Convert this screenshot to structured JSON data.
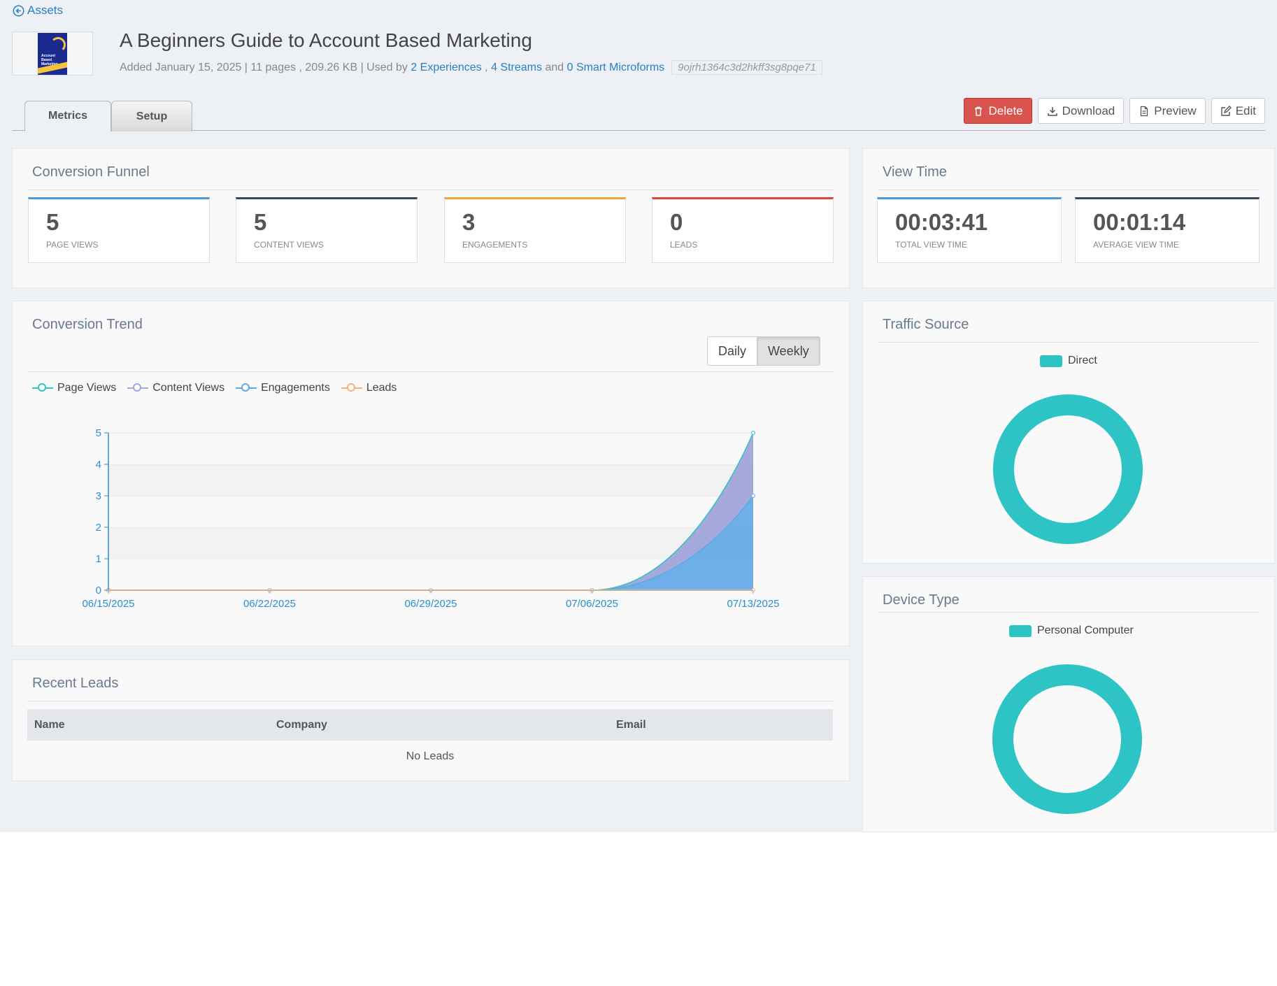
{
  "nav": {
    "back_label": "Assets"
  },
  "asset": {
    "thumbnail_title": "Account Based Marketing",
    "title": "A Beginners Guide to Account Based Marketing",
    "meta_prefix": "Added January 15, 2025 | 11 pages , 209.26 KB | Used by",
    "experiences_link": "2 Experiences",
    "sep_comma": ",",
    "streams_link": "4 Streams",
    "and_text": "and",
    "microforms_link": "0 Smart Microforms",
    "hash": "9ojrh1364c3d2hkff3sg8pqe71"
  },
  "tabs": [
    {
      "label": "Metrics",
      "active": true
    },
    {
      "label": "Setup",
      "active": false
    }
  ],
  "actions": {
    "delete": "Delete",
    "download": "Download",
    "preview": "Preview",
    "edit": "Edit"
  },
  "funnel": {
    "title": "Conversion Funnel",
    "stats": [
      {
        "value": "5",
        "label": "PAGE VIEWS",
        "color": "#4a9ad8"
      },
      {
        "value": "5",
        "label": "CONTENT VIEWS",
        "color": "#34495e"
      },
      {
        "value": "3",
        "label": "ENGAGEMENTS",
        "color": "#f0a53c"
      },
      {
        "value": "0",
        "label": "LEADS",
        "color": "#e0443a"
      }
    ]
  },
  "view_time": {
    "title": "View Time",
    "stats": [
      {
        "value": "00:03:41",
        "label": "TOTAL VIEW TIME",
        "color": "#4a9ad8"
      },
      {
        "value": "00:01:14",
        "label": "AVERAGE VIEW TIME",
        "color": "#34495e"
      }
    ]
  },
  "trend": {
    "title": "Conversion Trend",
    "toggle": {
      "daily": "Daily",
      "weekly": "Weekly",
      "selected": "Weekly"
    }
  },
  "chart_data": {
    "type": "area",
    "x": [
      "06/15/2025",
      "06/22/2025",
      "06/29/2025",
      "07/06/2025",
      "07/13/2025"
    ],
    "ylim": [
      0,
      5
    ],
    "yticks": [
      "0",
      "1",
      "2",
      "3",
      "4",
      "5"
    ],
    "series": [
      {
        "name": "Page Views",
        "values": [
          0,
          0,
          0,
          0,
          5
        ],
        "color": "#2ec4c6"
      },
      {
        "name": "Content Views",
        "values": [
          0,
          0,
          0,
          0,
          5
        ],
        "color": "#a3a8dc"
      },
      {
        "name": "Engagements",
        "values": [
          0,
          0,
          0,
          0,
          3
        ],
        "color": "#5aaae6"
      },
      {
        "name": "Leads",
        "values": [
          0,
          0,
          0,
          0,
          0
        ],
        "color": "#f5b07a"
      }
    ],
    "grid": true,
    "legend": "top-left"
  },
  "traffic": {
    "title": "Traffic Source",
    "legend": "Direct",
    "color": "#2ec4c6"
  },
  "device": {
    "title": "Device Type",
    "legend": "Personal Computer",
    "color": "#2ec4c6"
  },
  "leads": {
    "title": "Recent Leads",
    "columns": [
      "Name",
      "Company",
      "Email"
    ],
    "empty": "No Leads"
  }
}
